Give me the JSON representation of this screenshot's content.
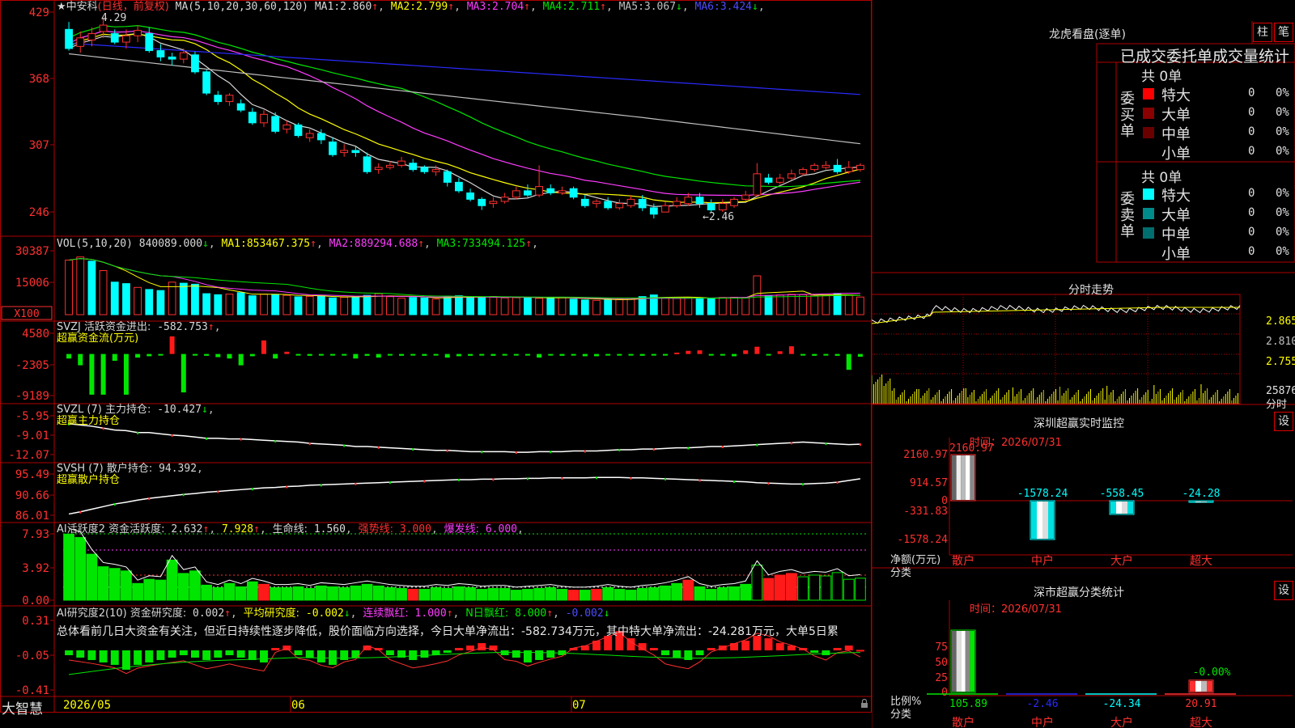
{
  "kline": {
    "stock_name": "★中安科",
    "period_label": "(日线，前复权)",
    "ma_header": "MA(5,10,20,30,60,120)",
    "ma": [
      {
        "label": "MA1:",
        "value": "2.860",
        "dir": "↑",
        "color": "#d8d8d8"
      },
      {
        "label": "MA2:",
        "value": "2.799",
        "dir": "↑",
        "color": "#ffff00"
      },
      {
        "label": "MA3:",
        "value": "2.704",
        "dir": "↑",
        "color": "#ff3cff"
      },
      {
        "label": "MA4:",
        "value": "2.711",
        "dir": "↑",
        "color": "#00e600"
      },
      {
        "label": "MA5:",
        "value": "3.067",
        "dir": "↓",
        "color": "#c0c0c0"
      },
      {
        "label": "MA6:",
        "value": "3.424",
        "dir": "↓",
        "color": "#4c4cff"
      }
    ],
    "y_ticks": [
      "429",
      "368",
      "307",
      "246"
    ],
    "high_label": "4.29",
    "low_label": "←2.46",
    "colors": {
      "up": "#ff3030",
      "down": "#00ffff",
      "ma5": "#d8d8d8",
      "ma10": "#ffff00",
      "ma20": "#ff3cff",
      "ma30": "#00e600",
      "ma60": "#c0c0c0",
      "ma120": "#2a2aff"
    }
  },
  "vol": {
    "header": "VOL(5,10,20)",
    "value": "840089.000",
    "value_dir": "↓",
    "ma": [
      {
        "label": "MA1:",
        "value": "853467.375",
        "dir": "↑",
        "color": "#ffff00"
      },
      {
        "label": "MA2:",
        "value": "889294.688",
        "dir": "↑",
        "color": "#ff3cff"
      },
      {
        "label": "MA3:",
        "value": "733494.125",
        "dir": "↑",
        "color": "#00e600"
      }
    ],
    "y_ticks": [
      "30387",
      "15006"
    ],
    "unit": "X100"
  },
  "svzj": {
    "header": "SVZJ  活跃资金进出:",
    "value": "-582.753",
    "dir": "↑",
    "subtitle": "超赢资金流(万元)",
    "y_ticks": [
      "4580",
      "-2305",
      "-9189"
    ]
  },
  "svzl": {
    "header": "SVZL (7) 主力持仓:",
    "value": "-10.427",
    "dir": "↓",
    "subtitle": "超赢主力持仓",
    "y_ticks": [
      "-5.95",
      "-9.01",
      "-12.07"
    ]
  },
  "svsh": {
    "header": "SVSH (7) 散户持仓:",
    "value": "94.392",
    "subtitle": "超赢散户持仓",
    "y_ticks": [
      "95.49",
      "90.66",
      "86.01"
    ]
  },
  "ai_active": {
    "header": "AI活跃度2 资金活跃度:",
    "value1": "2.632",
    "value2": "7.928",
    "life_label": "生命线:",
    "life_value": "1.560",
    "strong_label": "强势线:",
    "strong_value": "3.000",
    "burst_label": "爆发线:",
    "burst_value": "6.000",
    "y_ticks": [
      "7.93",
      "3.92",
      "0.00"
    ]
  },
  "ai_research": {
    "header": "AI研究度2(10) 资金研究度:",
    "v1": "0.002",
    "avg_label": "平均研究度:",
    "avg_value": "-0.002",
    "red_label": "连续飘红:",
    "red_value": "1.000",
    "nday_label": "N日飘红:",
    "nday_value": "8.000",
    "last_value": "-0.002",
    "comment": "总体看前几日大资金有关注，但近日持续性逐步降低，股价面临方向选择，今日大单净流出：-582.734万元，其中特大单净流出：-24.281万元，大单5日累",
    "y_ticks": [
      "0.31",
      "-0.05",
      "-0.41"
    ]
  },
  "footer": {
    "brand": "大智慧",
    "dates": [
      "2026/05",
      "06",
      "07"
    ]
  },
  "longhu": {
    "title": "龙虎看盘(逐单)",
    "btn_bar": "柱",
    "btn_pen": "笔",
    "section_title": "已成交委托单成交量统计",
    "buy_label": "委买单",
    "sell_label": "委卖单",
    "buy_total": "共 0单",
    "sell_total": "共 0单",
    "buy_rows": [
      {
        "name": "特大",
        "count": "0",
        "pct": "0%",
        "color": "#ff0000"
      },
      {
        "name": "大单",
        "count": "0",
        "pct": "0%",
        "color": "#8b0000"
      },
      {
        "name": "中单",
        "count": "0",
        "pct": "0%",
        "color": "#6a0000"
      },
      {
        "name": "小单",
        "count": "0",
        "pct": "0%",
        "color": ""
      }
    ],
    "sell_rows": [
      {
        "name": "特大",
        "count": "0",
        "pct": "0%",
        "color": "#00ffff"
      },
      {
        "name": "大单",
        "count": "0",
        "pct": "0%",
        "color": "#008b8b"
      },
      {
        "name": "中单",
        "count": "0",
        "pct": "0%",
        "color": "#006e6e"
      },
      {
        "name": "小单",
        "count": "0",
        "pct": "0%",
        "color": ""
      }
    ]
  },
  "intraday": {
    "title": "分时走势",
    "y_ticks": [
      "2.865",
      "2.810",
      "2.755"
    ],
    "vol_label": "25876",
    "time_label": "分时"
  },
  "shenzhen_monitor": {
    "title": "深圳超赢实时监控",
    "settings": "设",
    "time_label": "时间：2026/07/31",
    "y_ticks": [
      "2160.97",
      "914.57",
      "0",
      "-331.83",
      "-1578.24"
    ],
    "bars": [
      {
        "label": "散户",
        "value": "2160.97"
      },
      {
        "label": "中户",
        "value": "-1578.24"
      },
      {
        "label": "大户",
        "value": "-558.45"
      },
      {
        "label": "超大",
        "value": "-24.28"
      }
    ],
    "axis_label": "净额(万元)",
    "axis_label2": "分类"
  },
  "shenzhen_stats": {
    "title": "深市超赢分类统计",
    "settings": "设",
    "time_label": "时间：2026/07/31",
    "y_ticks": [
      "75",
      "50",
      "25",
      "0"
    ],
    "bars": [
      {
        "label": "散户",
        "value": "105.89"
      },
      {
        "label": "中户",
        "value": "-2.46"
      },
      {
        "label": "大户",
        "value": "-24.34"
      },
      {
        "label": "超大",
        "value": "20.91"
      }
    ],
    "extra_value": "-0.00%",
    "axis_label": "比例%",
    "axis_label2": "分类"
  },
  "chart_data": [
    {
      "type": "candlestick",
      "title": "中安科 日线 前复权",
      "ylim": [
        2.4,
        4.35
      ],
      "candles": [
        [
          4.18,
          4.0,
          4.25,
          3.98
        ],
        [
          4.02,
          4.1,
          4.16,
          3.96
        ],
        [
          4.08,
          4.14,
          4.2,
          4.02
        ],
        [
          4.16,
          4.22,
          4.29,
          4.1
        ],
        [
          4.14,
          4.06,
          4.18,
          4.04
        ],
        [
          4.06,
          4.12,
          4.18,
          4.0
        ],
        [
          4.12,
          4.17,
          4.22,
          4.06
        ],
        [
          4.14,
          3.98,
          4.2,
          3.96
        ],
        [
          3.98,
          3.92,
          4.04,
          3.88
        ],
        [
          3.92,
          3.9,
          3.96,
          3.84
        ],
        [
          3.9,
          3.96,
          4.0,
          3.86
        ],
        [
          3.94,
          3.78,
          3.97,
          3.76
        ],
        [
          3.78,
          3.58,
          3.8,
          3.56
        ],
        [
          3.56,
          3.5,
          3.6,
          3.47
        ],
        [
          3.5,
          3.56,
          3.58,
          3.46
        ],
        [
          3.48,
          3.42,
          3.52,
          3.4
        ],
        [
          3.4,
          3.3,
          3.44,
          3.28
        ],
        [
          3.3,
          3.38,
          3.42,
          3.26
        ],
        [
          3.36,
          3.22,
          3.4,
          3.2
        ],
        [
          3.24,
          3.28,
          3.32,
          3.2
        ],
        [
          3.28,
          3.18,
          3.3,
          3.16
        ],
        [
          3.16,
          3.2,
          3.24,
          3.12
        ],
        [
          3.2,
          3.14,
          3.24,
          3.1
        ],
        [
          3.12,
          3.0,
          3.16,
          2.98
        ],
        [
          3.02,
          3.04,
          3.1,
          2.98
        ],
        [
          3.04,
          3.02,
          3.08,
          2.98
        ],
        [
          2.98,
          2.84,
          3.02,
          2.82
        ],
        [
          2.86,
          2.88,
          2.92,
          2.82
        ],
        [
          2.88,
          2.9,
          2.94,
          2.86
        ],
        [
          2.9,
          2.94,
          2.98,
          2.88
        ],
        [
          2.92,
          2.86,
          2.96,
          2.84
        ],
        [
          2.88,
          2.84,
          2.9,
          2.82
        ],
        [
          2.84,
          2.86,
          2.9,
          2.8
        ],
        [
          2.84,
          2.74,
          2.86,
          2.7
        ],
        [
          2.74,
          2.66,
          2.78,
          2.64
        ],
        [
          2.64,
          2.58,
          2.68,
          2.56
        ],
        [
          2.58,
          2.52,
          2.6,
          2.48
        ],
        [
          2.54,
          2.56,
          2.6,
          2.5
        ],
        [
          2.56,
          2.6,
          2.64,
          2.54
        ],
        [
          2.6,
          2.66,
          2.7,
          2.58
        ],
        [
          2.66,
          2.62,
          2.72,
          2.6
        ],
        [
          2.62,
          2.7,
          2.9,
          2.6
        ],
        [
          2.68,
          2.64,
          2.72,
          2.62
        ],
        [
          2.64,
          2.66,
          2.7,
          2.62
        ],
        [
          2.68,
          2.6,
          2.7,
          2.58
        ],
        [
          2.58,
          2.52,
          2.62,
          2.5
        ],
        [
          2.54,
          2.56,
          2.58,
          2.5
        ],
        [
          2.56,
          2.5,
          2.6,
          2.48
        ],
        [
          2.5,
          2.54,
          2.58,
          2.48
        ],
        [
          2.52,
          2.58,
          2.62,
          2.5
        ],
        [
          2.58,
          2.5,
          2.62,
          2.47
        ],
        [
          2.5,
          2.44,
          2.54,
          2.4
        ],
        [
          2.46,
          2.52,
          2.56,
          2.46
        ],
        [
          2.52,
          2.56,
          2.6,
          2.5
        ],
        [
          2.54,
          2.6,
          2.64,
          2.52
        ],
        [
          2.6,
          2.54,
          2.64,
          2.5
        ],
        [
          2.54,
          2.48,
          2.58,
          2.46
        ],
        [
          2.48,
          2.54,
          2.58,
          2.46
        ],
        [
          2.52,
          2.58,
          2.6,
          2.5
        ],
        [
          2.58,
          2.62,
          2.66,
          2.56
        ],
        [
          2.62,
          2.82,
          2.92,
          2.6
        ],
        [
          2.78,
          2.74,
          2.82,
          2.72
        ],
        [
          2.74,
          2.78,
          2.82,
          2.72
        ],
        [
          2.78,
          2.82,
          2.86,
          2.76
        ],
        [
          2.82,
          2.86,
          2.88,
          2.8
        ],
        [
          2.86,
          2.9,
          2.92,
          2.84
        ],
        [
          2.88,
          2.9,
          2.94,
          2.86
        ],
        [
          2.9,
          2.84,
          2.96,
          2.82
        ],
        [
          2.84,
          2.88,
          2.94,
          2.82
        ],
        [
          2.86,
          2.9,
          2.92,
          2.84
        ]
      ]
    },
    {
      "type": "bar",
      "title": "VOL",
      "ylim": [
        0,
        32000
      ],
      "unit": "X100",
      "values": [
        26000,
        27500,
        25500,
        21000,
        15500,
        14800,
        13000,
        12000,
        11500,
        15500,
        15000,
        14500,
        10000,
        9500,
        9800,
        10500,
        9000,
        9800,
        9500,
        9200,
        8500,
        8700,
        9000,
        8000,
        8300,
        8400,
        9200,
        10000,
        8600,
        7800,
        8200,
        8000,
        7400,
        8800,
        9000,
        8400,
        8200,
        8600,
        8000,
        8100,
        8200,
        7800,
        8100,
        8300,
        7400,
        7000,
        6800,
        7200,
        7300,
        7900,
        8600,
        9400,
        8100,
        7800,
        8000,
        7900,
        7500,
        8200,
        8300,
        8200,
        18500,
        9000,
        9400,
        9700,
        9500,
        9200,
        9100,
        10100,
        9400,
        8400
      ],
      "up": [
        1,
        1,
        0,
        1,
        0,
        0,
        1,
        0,
        0,
        1,
        0,
        0,
        0,
        0,
        1,
        0,
        0,
        1,
        0,
        1,
        0,
        1,
        0,
        0,
        1,
        0,
        0,
        1,
        1,
        1,
        0,
        0,
        1,
        0,
        0,
        0,
        0,
        1,
        1,
        1,
        0,
        1,
        0,
        1,
        0,
        0,
        1,
        0,
        1,
        1,
        0,
        0,
        1,
        1,
        1,
        0,
        0,
        1,
        1,
        1,
        1,
        0,
        1,
        1,
        1,
        1,
        1,
        0,
        1,
        1
      ]
    },
    {
      "type": "bar",
      "title": "超赢资金流(万元)",
      "ylim": [
        -9189,
        4580
      ],
      "values": [
        -1000,
        -2500,
        -9000,
        -9000,
        -1500,
        -9000,
        -800,
        -500,
        -300,
        3900,
        -8500,
        -300,
        -400,
        -700,
        -1000,
        -2500,
        -500,
        3000,
        -1000,
        500,
        -300,
        -400,
        -300,
        -300,
        -200,
        -1000,
        -400,
        -800,
        -300,
        -400,
        -300,
        -400,
        -300,
        -800,
        -500,
        -400,
        -300,
        -400,
        -200,
        -300,
        -300,
        -800,
        -300,
        -400,
        -300,
        -500,
        -500,
        -300,
        -200,
        -300,
        -400,
        -200,
        -300,
        300,
        700,
        800,
        -300,
        -300,
        -500,
        800,
        1600,
        -300,
        600,
        1700,
        -300,
        -400,
        -200,
        -400,
        -3500,
        -600
      ]
    },
    {
      "type": "line",
      "title": "超赢主力持仓",
      "ylim": [
        -12.07,
        -5.95
      ],
      "values": [
        -7.2,
        -7.4,
        -7.6,
        -7.9,
        -8.2,
        -8.3,
        -8.6,
        -8.6,
        -8.8,
        -9.0,
        -9.1,
        -9.3,
        -9.5,
        -9.5,
        -9.6,
        -9.6,
        -9.7,
        -9.8,
        -9.9,
        -10.0,
        -10.1,
        -10.3,
        -10.4,
        -10.5,
        -10.6,
        -10.8,
        -10.8,
        -10.9,
        -11.0,
        -11.1,
        -11.2,
        -11.3,
        -11.4,
        -11.4,
        -11.5,
        -11.6,
        -11.6,
        -11.6,
        -11.6,
        -11.7,
        -11.7,
        -11.6,
        -11.6,
        -11.6,
        -11.5,
        -11.5,
        -11.5,
        -11.4,
        -11.3,
        -11.3,
        -11.2,
        -11.2,
        -11.1,
        -11.0,
        -11.0,
        -10.9,
        -10.8,
        -10.8,
        -10.7,
        -10.6,
        -10.5,
        -10.4,
        -10.3,
        -10.2,
        -10.1,
        -10.2,
        -10.3,
        -10.4,
        -10.5,
        -10.43
      ]
    },
    {
      "type": "line",
      "title": "超赢散户持仓",
      "ylim": [
        86.01,
        95.49
      ],
      "values": [
        86.3,
        86.8,
        87.4,
        88.0,
        88.6,
        89.0,
        89.5,
        89.9,
        90.2,
        90.5,
        90.8,
        91.0,
        91.3,
        91.5,
        91.7,
        91.9,
        92.1,
        92.3,
        92.4,
        92.6,
        92.7,
        92.9,
        93.0,
        93.1,
        93.2,
        93.3,
        93.4,
        93.5,
        93.6,
        93.7,
        93.8,
        93.9,
        94.0,
        94.1,
        94.2,
        94.2,
        94.3,
        94.3,
        94.4,
        94.4,
        94.5,
        94.5,
        94.6,
        94.6,
        94.6,
        94.6,
        94.7,
        94.7,
        94.7,
        94.6,
        94.6,
        94.5,
        94.4,
        94.3,
        94.2,
        94.1,
        94.0,
        93.9,
        93.8,
        93.7,
        93.5,
        93.4,
        93.3,
        93.2,
        93.2,
        93.3,
        93.4,
        93.6,
        94.0,
        94.39
      ]
    },
    {
      "type": "bar",
      "title": "AI活跃度2",
      "ylim": [
        0,
        7.93
      ],
      "values": [
        7.9,
        7.5,
        5.5,
        4.0,
        3.8,
        3.5,
        2.0,
        2.5,
        2.4,
        4.8,
        3.2,
        3.5,
        1.8,
        1.5,
        2.0,
        1.6,
        2.2,
        1.9,
        1.5,
        1.5,
        1.6,
        1.4,
        1.7,
        1.6,
        1.5,
        1.7,
        1.9,
        1.7,
        1.5,
        1.4,
        1.3,
        1.3,
        1.5,
        1.4,
        1.6,
        1.5,
        1.3,
        1.4,
        1.4,
        1.2,
        1.3,
        1.4,
        1.5,
        1.3,
        1.2,
        1.2,
        1.3,
        1.5,
        1.3,
        1.2,
        1.4,
        1.5,
        1.7,
        2.0,
        2.4,
        1.6,
        1.3,
        1.5,
        1.6,
        1.9,
        4.2,
        2.6,
        3.0,
        3.2,
        2.8,
        3.0,
        2.9,
        3.3,
        2.5,
        2.63
      ],
      "color": "#00e600"
    },
    {
      "type": "bar",
      "title": "AI研究度2",
      "ylim": [
        -0.41,
        0.31
      ],
      "values": [
        -0.02,
        -0.03,
        -0.04,
        -0.05,
        -0.06,
        -0.08,
        -0.06,
        -0.05,
        -0.04,
        -0.03,
        -0.02,
        -0.03,
        -0.04,
        -0.03,
        -0.02,
        -0.03,
        -0.04,
        -0.05,
        0.01,
        0.02,
        -0.02,
        -0.03,
        -0.05,
        -0.06,
        -0.04,
        -0.03,
        0.02,
        0.01,
        -0.02,
        -0.03,
        -0.04,
        -0.03,
        -0.02,
        -0.01,
        0.01,
        0.02,
        0.03,
        0.02,
        -0.02,
        -0.03,
        -0.05,
        -0.04,
        -0.03,
        -0.02,
        0.01,
        0.02,
        0.04,
        0.06,
        0.08,
        0.05,
        0.03,
        0.01,
        -0.02,
        -0.03,
        -0.04,
        -0.02,
        0.01,
        0.02,
        0.03,
        0.04,
        0.06,
        0.05,
        0.03,
        0.02,
        0.01,
        -0.01,
        -0.02,
        0.01,
        0.02,
        0.002
      ]
    }
  ]
}
